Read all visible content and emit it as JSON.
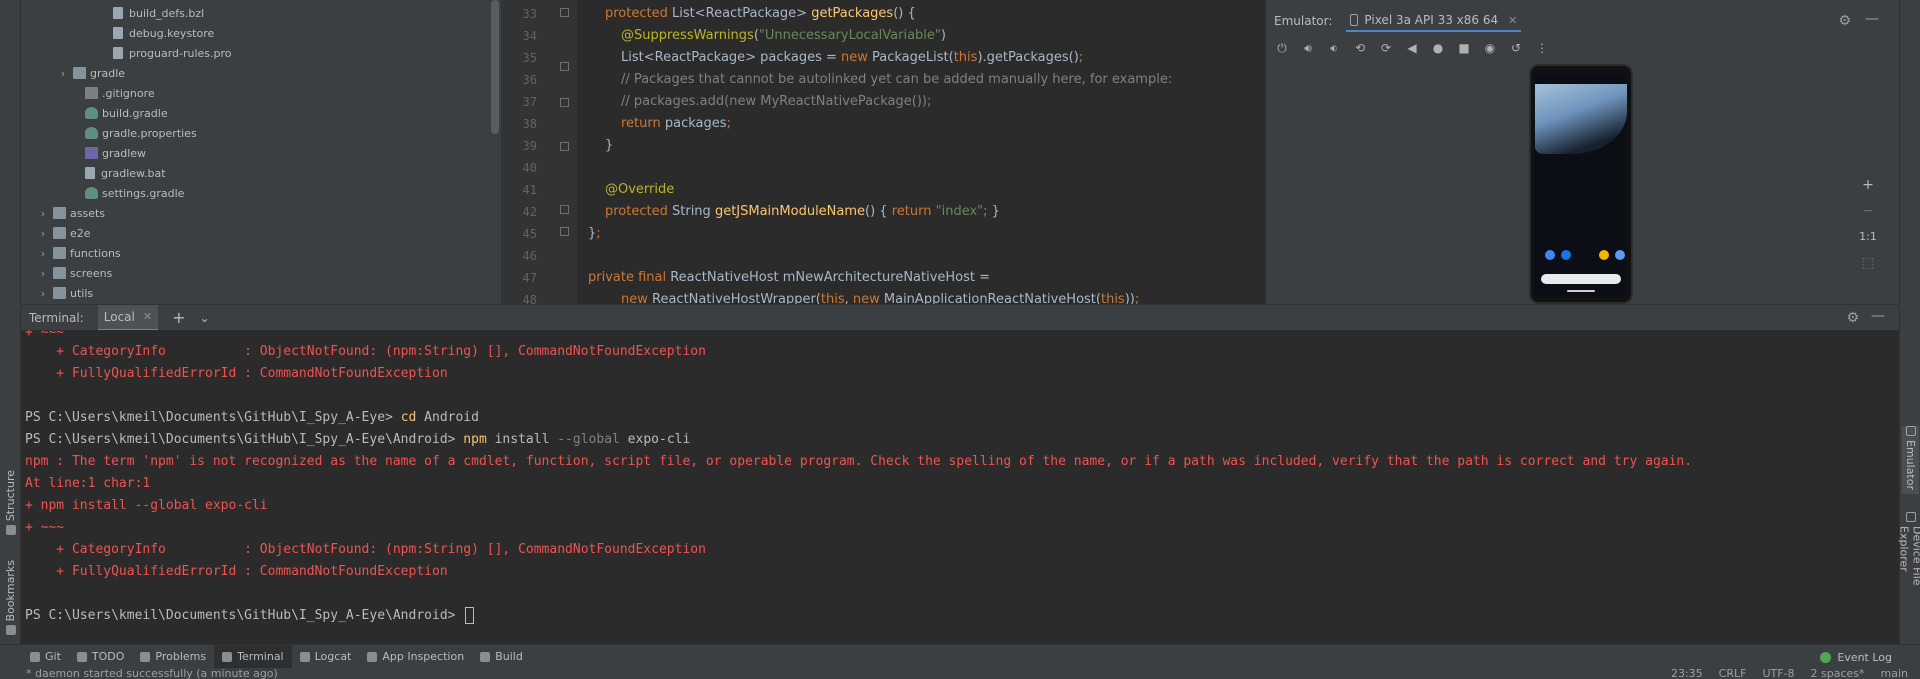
{
  "left_strip": {
    "structure_label": "Structure",
    "bookmarks_label": "Bookmarks"
  },
  "right_strip": {
    "emulator_label": "Emulator",
    "device_explorer_label": "Device File Explorer"
  },
  "project_tree": {
    "items": [
      {
        "label": "build_defs.bzl",
        "icon": "file-icon",
        "expandable": false
      },
      {
        "label": "debug.keystore",
        "icon": "file-icon",
        "expandable": false
      },
      {
        "label": "proguard-rules.pro",
        "icon": "file-icon",
        "expandable": false
      },
      {
        "label": "gradle",
        "icon": "folder-icon",
        "expandable": true
      },
      {
        "label": ".gitignore",
        "icon": "gitignore-icon",
        "expandable": false
      },
      {
        "label": "build.gradle",
        "icon": "gradle-icon",
        "expandable": false
      },
      {
        "label": "gradle.properties",
        "icon": "gradle-icon",
        "expandable": false
      },
      {
        "label": "gradlew",
        "icon": "gradlew-icon",
        "expandable": false
      },
      {
        "label": "gradlew.bat",
        "icon": "file-icon",
        "expandable": false
      },
      {
        "label": "settings.gradle",
        "icon": "gradle-icon",
        "expandable": false
      },
      {
        "label": "assets",
        "icon": "folder-icon",
        "expandable": true
      },
      {
        "label": "e2e",
        "icon": "folder-icon",
        "expandable": true
      },
      {
        "label": "functions",
        "icon": "folder-icon",
        "expandable": true
      },
      {
        "label": "screens",
        "icon": "folder-icon",
        "expandable": true
      },
      {
        "label": "utils",
        "icon": "folder-icon",
        "expandable": true
      }
    ]
  },
  "editor": {
    "line_numbers": [
      "33",
      "34",
      "35",
      "36",
      "37",
      "38",
      "39",
      "40",
      "41",
      "42",
      "45",
      "46",
      "47",
      "48"
    ]
  },
  "emulator": {
    "title": "Emulator:",
    "device_tab": "Pixel 3a API 33 x86 64",
    "zoom_in": "+",
    "zoom_out": "−",
    "ratio": "1:1"
  },
  "terminal": {
    "title": "Terminal:",
    "tab_label": "Local",
    "lines": {
      "l0": "+ ~~~",
      "l1": "    + CategoryInfo          : ObjectNotFound: (npm:String) [], CommandNotFoundException",
      "l2": "    + FullyQualifiedErrorId : CommandNotFoundException",
      "l3_prompt": "PS C:\\Users\\kmeil\\Documents\\GitHub\\I_Spy_A-Eye> ",
      "l3_cmd": "cd",
      "l3_arg": " Android",
      "l4_prompt": "PS C:\\Users\\kmeil\\Documents\\GitHub\\I_Spy_A-Eye\\Android> ",
      "l4_cmd": "npm",
      "l4_arg1": " install ",
      "l4_flag": "--global",
      "l4_arg2": " expo-cli",
      "l5": "npm : The term 'npm' is not recognized as the name of a cmdlet, function, script file, or operable program. Check the spelling of the name, or if a path was included, verify that the path is correct and try again.",
      "l6": "At line:1 char:1",
      "l7": "+ npm install --global expo-cli",
      "l8": "+ ~~~",
      "l9": "    + CategoryInfo          : ObjectNotFound: (npm:String) [], CommandNotFoundException",
      "l10": "    + FullyQualifiedErrorId : CommandNotFoundException",
      "l11_prompt": "PS C:\\Users\\kmeil\\Documents\\GitHub\\I_Spy_A-Eye\\Android> "
    }
  },
  "bottom_tabs": [
    {
      "label": "Git",
      "name": "tab-git",
      "active": false
    },
    {
      "label": "TODO",
      "name": "tab-todo",
      "active": false
    },
    {
      "label": "Problems",
      "name": "tab-problems",
      "active": false
    },
    {
      "label": "Terminal",
      "name": "tab-terminal",
      "active": true
    },
    {
      "label": "Logcat",
      "name": "tab-logcat",
      "active": false
    },
    {
      "label": "App Inspection",
      "name": "tab-app-inspection",
      "active": false
    },
    {
      "label": "Build",
      "name": "tab-build",
      "active": false
    }
  ],
  "event_log": "Event Log",
  "status_bar": {
    "message": "* daemon started successfully (a minute ago)",
    "position": "23:35",
    "line_ending": "CRLF",
    "encoding": "UTF-8",
    "indent": "2 spaces*",
    "branch": "main"
  },
  "colors": {
    "error": "#f0524f",
    "accent": "#4a88c7",
    "panel_bg": "#3c3f41",
    "editor_bg": "#2b2b2b"
  }
}
